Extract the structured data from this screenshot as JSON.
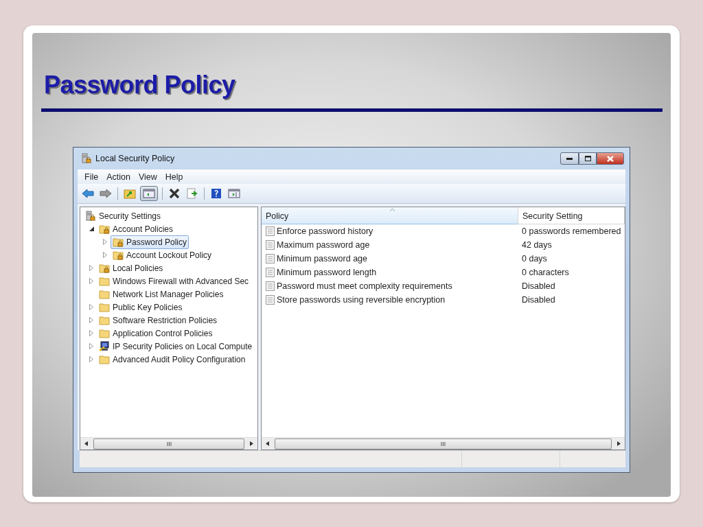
{
  "slide": {
    "title": "Password Policy"
  },
  "window": {
    "title": "Local Security Policy"
  },
  "menu": [
    "File",
    "Action",
    "View",
    "Help"
  ],
  "toolbar": [
    {
      "kind": "back",
      "pressed": false
    },
    {
      "kind": "forward",
      "pressed": false
    },
    {
      "kind": "separator"
    },
    {
      "kind": "up",
      "pressed": false
    },
    {
      "kind": "tree",
      "pressed": true
    },
    {
      "kind": "separator"
    },
    {
      "kind": "delete",
      "pressed": false
    },
    {
      "kind": "export",
      "pressed": false
    },
    {
      "kind": "separator"
    },
    {
      "kind": "help",
      "pressed": false
    },
    {
      "kind": "pane",
      "pressed": false
    }
  ],
  "tree": [
    {
      "label": "Security Settings",
      "kind": "root",
      "selected": false,
      "children": [
        {
          "label": "Account Policies",
          "kind": "locked",
          "expanded": true,
          "selected": false,
          "children": [
            {
              "label": "Password Policy",
              "kind": "locked",
              "expanded": false,
              "selected": true
            },
            {
              "label": "Account Lockout Policy",
              "kind": "locked",
              "expanded": false,
              "selected": false
            }
          ]
        },
        {
          "label": "Local Policies",
          "kind": "locked",
          "expanded": false,
          "selected": false
        },
        {
          "label": "Windows Firewall with Advanced Sec",
          "kind": "folder",
          "expanded": false,
          "selected": false
        },
        {
          "label": "Network List Manager Policies",
          "kind": "folder",
          "selected": false
        },
        {
          "label": "Public Key Policies",
          "kind": "folder",
          "expanded": false,
          "selected": false
        },
        {
          "label": "Software Restriction Policies",
          "kind": "folder",
          "expanded": false,
          "selected": false
        },
        {
          "label": "Application Control Policies",
          "kind": "folder",
          "expanded": false,
          "selected": false
        },
        {
          "label": "IP Security Policies on Local Compute",
          "kind": "computer",
          "expanded": false,
          "selected": false
        },
        {
          "label": "Advanced Audit Policy Configuration",
          "kind": "folder",
          "expanded": false,
          "selected": false
        }
      ]
    }
  ],
  "table": {
    "columns": [
      "Policy",
      "Security Setting"
    ],
    "rows": [
      [
        "Enforce password history",
        "0 passwords remembered"
      ],
      [
        "Maximum password age",
        "42 days"
      ],
      [
        "Minimum password age",
        "0 days"
      ],
      [
        "Minimum password length",
        "0 characters"
      ],
      [
        "Password must meet complexity requirements",
        "Disabled"
      ],
      [
        "Store passwords using reversible encryption",
        "Disabled"
      ]
    ]
  }
}
